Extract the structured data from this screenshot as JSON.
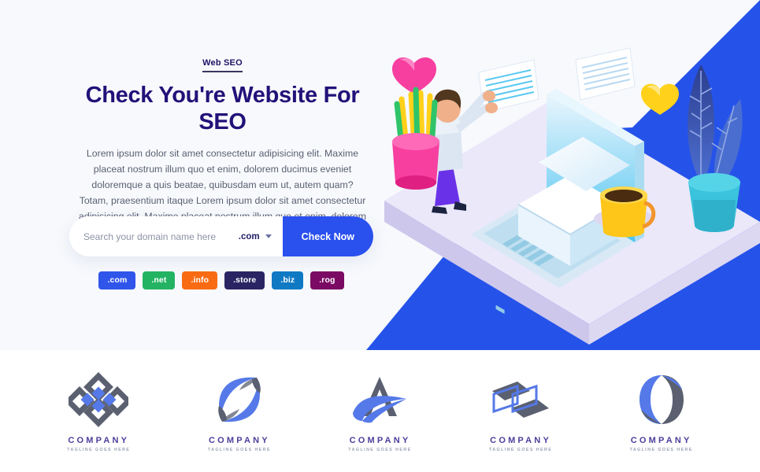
{
  "hero": {
    "eyebrow": "Web SEO",
    "title": "Check You're Website For SEO",
    "paragraph": "Lorem ipsum dolor sit amet consectetur adipisicing elit. Maxime placeat nostrum illum quo et enim, dolorem ducimus eveniet doloremque a quis beatae, quibusdam eum ut, autem quam? Totam, praesentium itaque Lorem ipsum dolor sit amet consectetur adipisicing elit. Maxime placeat nostrum illum quo et enim, dolorem ducimus eveniet doloremque a quis beatae, quibusdam eum ut, autem quam? Totam, praesentium itaque",
    "background_color": "#f7f9fc",
    "accent_color": "#2553ea",
    "title_color": "#231179"
  },
  "search": {
    "placeholder": "Search your domain name here",
    "value": "",
    "tld_selected": ".com",
    "tld_options": [
      ".com",
      ".net",
      ".info",
      ".store",
      ".biz",
      ".rog"
    ],
    "button_label": "Check Now",
    "button_color": "#2a50ee"
  },
  "tld_badges": [
    {
      "label": ".com",
      "color": "#2f55ea"
    },
    {
      "label": ".net",
      "color": "#24b362"
    },
    {
      "label": ".info",
      "color": "#f96b13"
    },
    {
      "label": ".store",
      "color": "#2a2463"
    },
    {
      "label": ".biz",
      "color": "#1079c4"
    },
    {
      "label": ".rog",
      "color": "#7a0a63"
    }
  ],
  "illustration": {
    "name": "isometric-desk-email-illustration",
    "elements": [
      "laptop",
      "envelope",
      "person",
      "pencil-cup",
      "coffee-mug",
      "potted-plant",
      "pink-heart",
      "yellow-heart",
      "message-panels"
    ]
  },
  "logos": [
    {
      "name": "COMPANY",
      "tagline": "TAGLINE GOES HERE",
      "mark": "diamond-cluster-logo"
    },
    {
      "name": "COMPANY",
      "tagline": "TAGLINE GOES HERE",
      "mark": "swirl-square-logo"
    },
    {
      "name": "COMPANY",
      "tagline": "TAGLINE GOES HERE",
      "mark": "letter-a-swoosh-logo"
    },
    {
      "name": "COMPANY",
      "tagline": "TAGLINE GOES HERE",
      "mark": "double-chevron-logo"
    },
    {
      "name": "COMPANY",
      "tagline": "TAGLINE GOES HERE",
      "mark": "circle-split-logo"
    }
  ]
}
